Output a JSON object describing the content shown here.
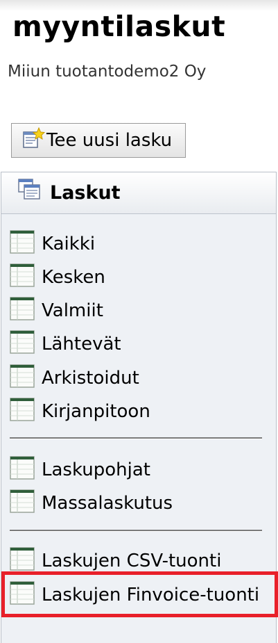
{
  "header": {
    "title": "myyntilaskut",
    "company": "Miiun tuotantodemo2 Oy"
  },
  "toolbar": {
    "new_invoice_label": "Tee uusi lasku",
    "new_invoice_icon": "new-document-star-icon"
  },
  "sidebar": {
    "title": "Laskut",
    "title_icon": "documents-icon",
    "items": [
      {
        "label": "Kaikki",
        "icon": "list-icon"
      },
      {
        "label": "Kesken",
        "icon": "list-icon"
      },
      {
        "label": "Valmiit",
        "icon": "list-icon"
      },
      {
        "label": "Lähtevät",
        "icon": "list-icon"
      },
      {
        "label": "Arkistoidut",
        "icon": "list-icon"
      },
      {
        "label": "Kirjanpitoon",
        "icon": "list-icon"
      },
      {
        "label": "Laskupohjat",
        "icon": "list-icon"
      },
      {
        "label": "Massalaskutus",
        "icon": "list-icon"
      },
      {
        "label": "Laskujen CSV-tuonti",
        "icon": "list-icon"
      },
      {
        "label": "Laskujen Finvoice-tuonti",
        "icon": "list-icon",
        "highlighted": true
      }
    ]
  },
  "colors": {
    "highlight_border": "#e8202a",
    "panel_background": "#eef1f5",
    "icon_header": "#2f5e3a"
  }
}
